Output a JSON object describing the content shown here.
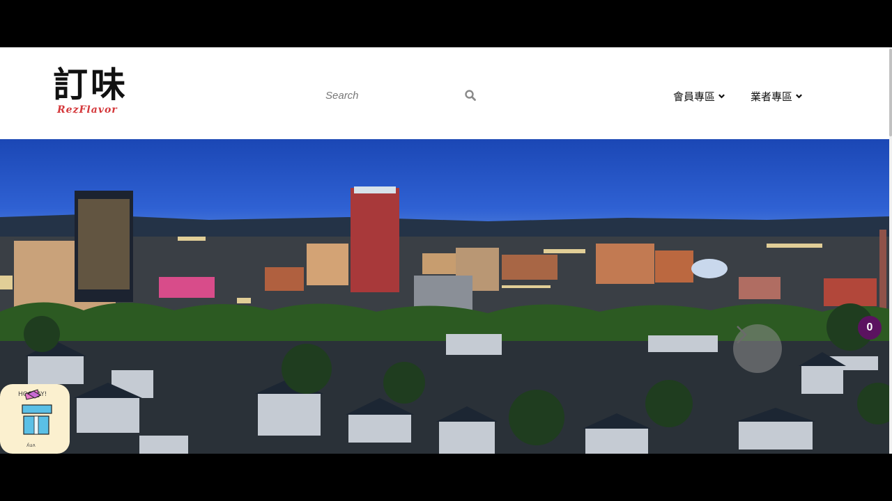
{
  "logo": {
    "glyphs": "訂味",
    "subtitle": "RezFlavor"
  },
  "search": {
    "placeholder": "Search"
  },
  "nav": {
    "items": [
      {
        "label": "會員專區"
      },
      {
        "label": "業者專區"
      }
    ]
  },
  "hero": {
    "image": "city-skyline-at-dusk"
  },
  "cart": {
    "count": "0",
    "color": "#5b1260"
  },
  "icons": {
    "search": "search-icon",
    "next": "chevron-right-icon",
    "dropdown": "chevron-down-icon",
    "gift": "gift-box-icon"
  },
  "colors": {
    "header_bg": "#ffffff",
    "logo_accent": "#d4373a",
    "badge": "#5b1260"
  }
}
